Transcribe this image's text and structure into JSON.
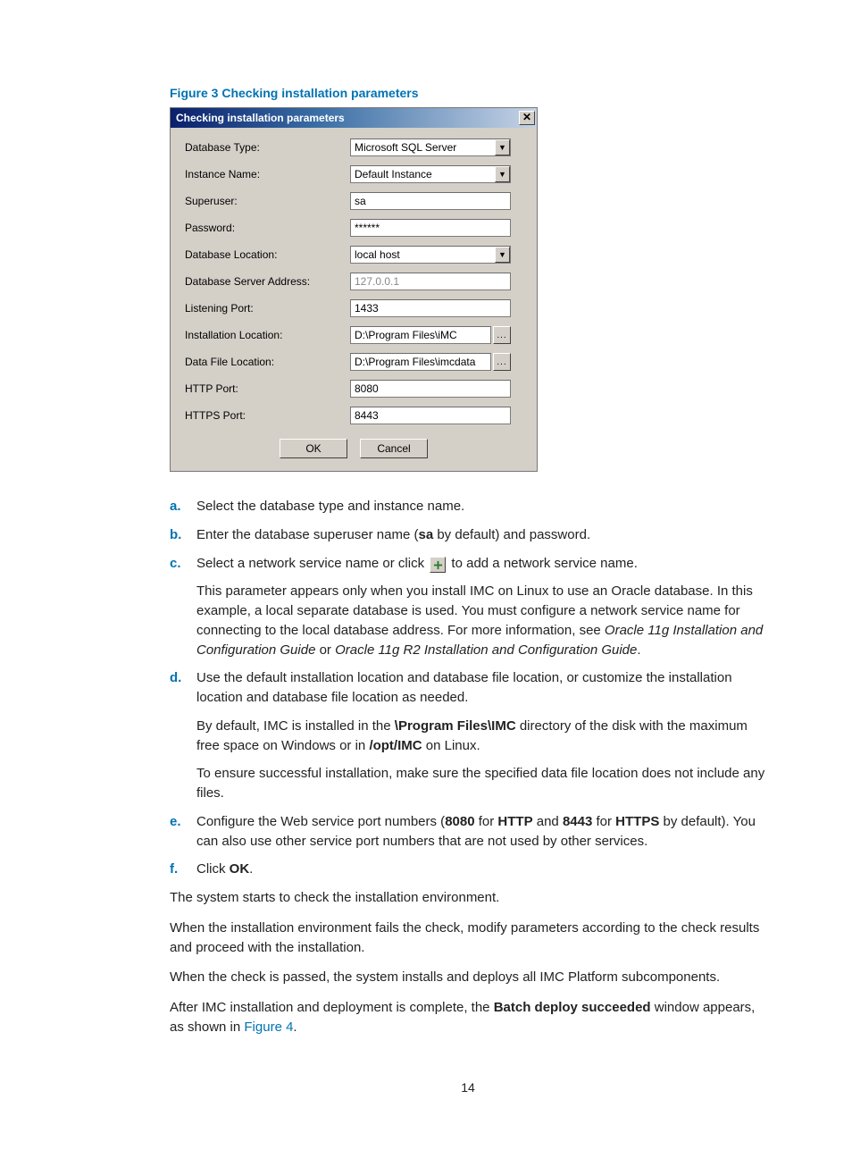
{
  "figure_caption": "Figure 3 Checking installation parameters",
  "dialog": {
    "title": "Checking installation parameters",
    "close_glyph": "✕",
    "fields": {
      "db_type_label": "Database Type:",
      "db_type_value": "Microsoft SQL Server",
      "instance_label": "Instance Name:",
      "instance_value": "Default Instance",
      "superuser_label": "Superuser:",
      "superuser_value": "sa",
      "password_label": "Password:",
      "password_value": "******",
      "db_loc_label": "Database Location:",
      "db_loc_value": "local host",
      "db_addr_label": "Database Server Address:",
      "db_addr_value": "127.0.0.1",
      "listen_port_label": "Listening Port:",
      "listen_port_value": "1433",
      "install_loc_label": "Installation Location:",
      "install_loc_value": "D:\\Program Files\\iMC",
      "data_loc_label": "Data File Location:",
      "data_loc_value": "D:\\Program Files\\imcdata",
      "http_port_label": "HTTP Port:",
      "http_port_value": "8080",
      "https_port_label": "HTTPS Port:",
      "https_port_value": "8443"
    },
    "browse_glyph": "...",
    "ok_label": "OK",
    "cancel_label": "Cancel"
  },
  "steps": {
    "a_marker": "a.",
    "a_text": "Select the database type and instance name.",
    "b_marker": "b.",
    "b_pre": "Enter the database superuser name (",
    "b_bold1": "sa",
    "b_post": " by default) and password.",
    "c_marker": "c.",
    "c_pre": "Select a network service name or click ",
    "c_post": " to add a network service name.",
    "c_p2_pre": "This parameter appears only when you install IMC on Linux to use an Oracle database. In this example, a local separate database is used. You must configure a network service name for connecting to the local database address. For more information, see ",
    "c_p2_i1": "Oracle 11g Installation and Configuration Guide",
    "c_p2_mid": " or ",
    "c_p2_i2": "Oracle 11g R2 Installation and Configuration Guide",
    "c_p2_end": ".",
    "d_marker": "d.",
    "d_p1": "Use the default installation location and database file location, or customize the installation location and database file location as needed.",
    "d_p2_pre": "By default, IMC is installed in the ",
    "d_p2_b1": "\\Program Files\\IMC",
    "d_p2_mid": " directory of the disk with the maximum free space on Windows or in ",
    "d_p2_b2": "/opt/IMC",
    "d_p2_end": " on Linux.",
    "d_p3": "To ensure successful installation, make sure the specified data file location does not include any files.",
    "e_marker": "e.",
    "e_pre": "Configure the Web service port numbers (",
    "e_b1": "8080",
    "e_mid1": " for ",
    "e_b2": "HTTP",
    "e_mid2": " and ",
    "e_b3": "8443",
    "e_mid3": " for ",
    "e_b4": "HTTPS",
    "e_end": " by default). You can also use other service port numbers that are not used by other services.",
    "f_marker": "f.",
    "f_pre": "Click ",
    "f_b1": "OK",
    "f_end": "."
  },
  "body": {
    "p1": "The system starts to check the installation environment.",
    "p2": "When the installation environment fails the check, modify parameters according to the check results and proceed with the installation.",
    "p3": "When the check is passed, the system installs and deploys all IMC Platform subcomponents.",
    "p4_pre": "After IMC installation and deployment is complete, the ",
    "p4_b": "Batch deploy succeeded",
    "p4_mid": " window appears, as shown in ",
    "p4_link": "Figure 4",
    "p4_end": "."
  },
  "page_number": "14"
}
